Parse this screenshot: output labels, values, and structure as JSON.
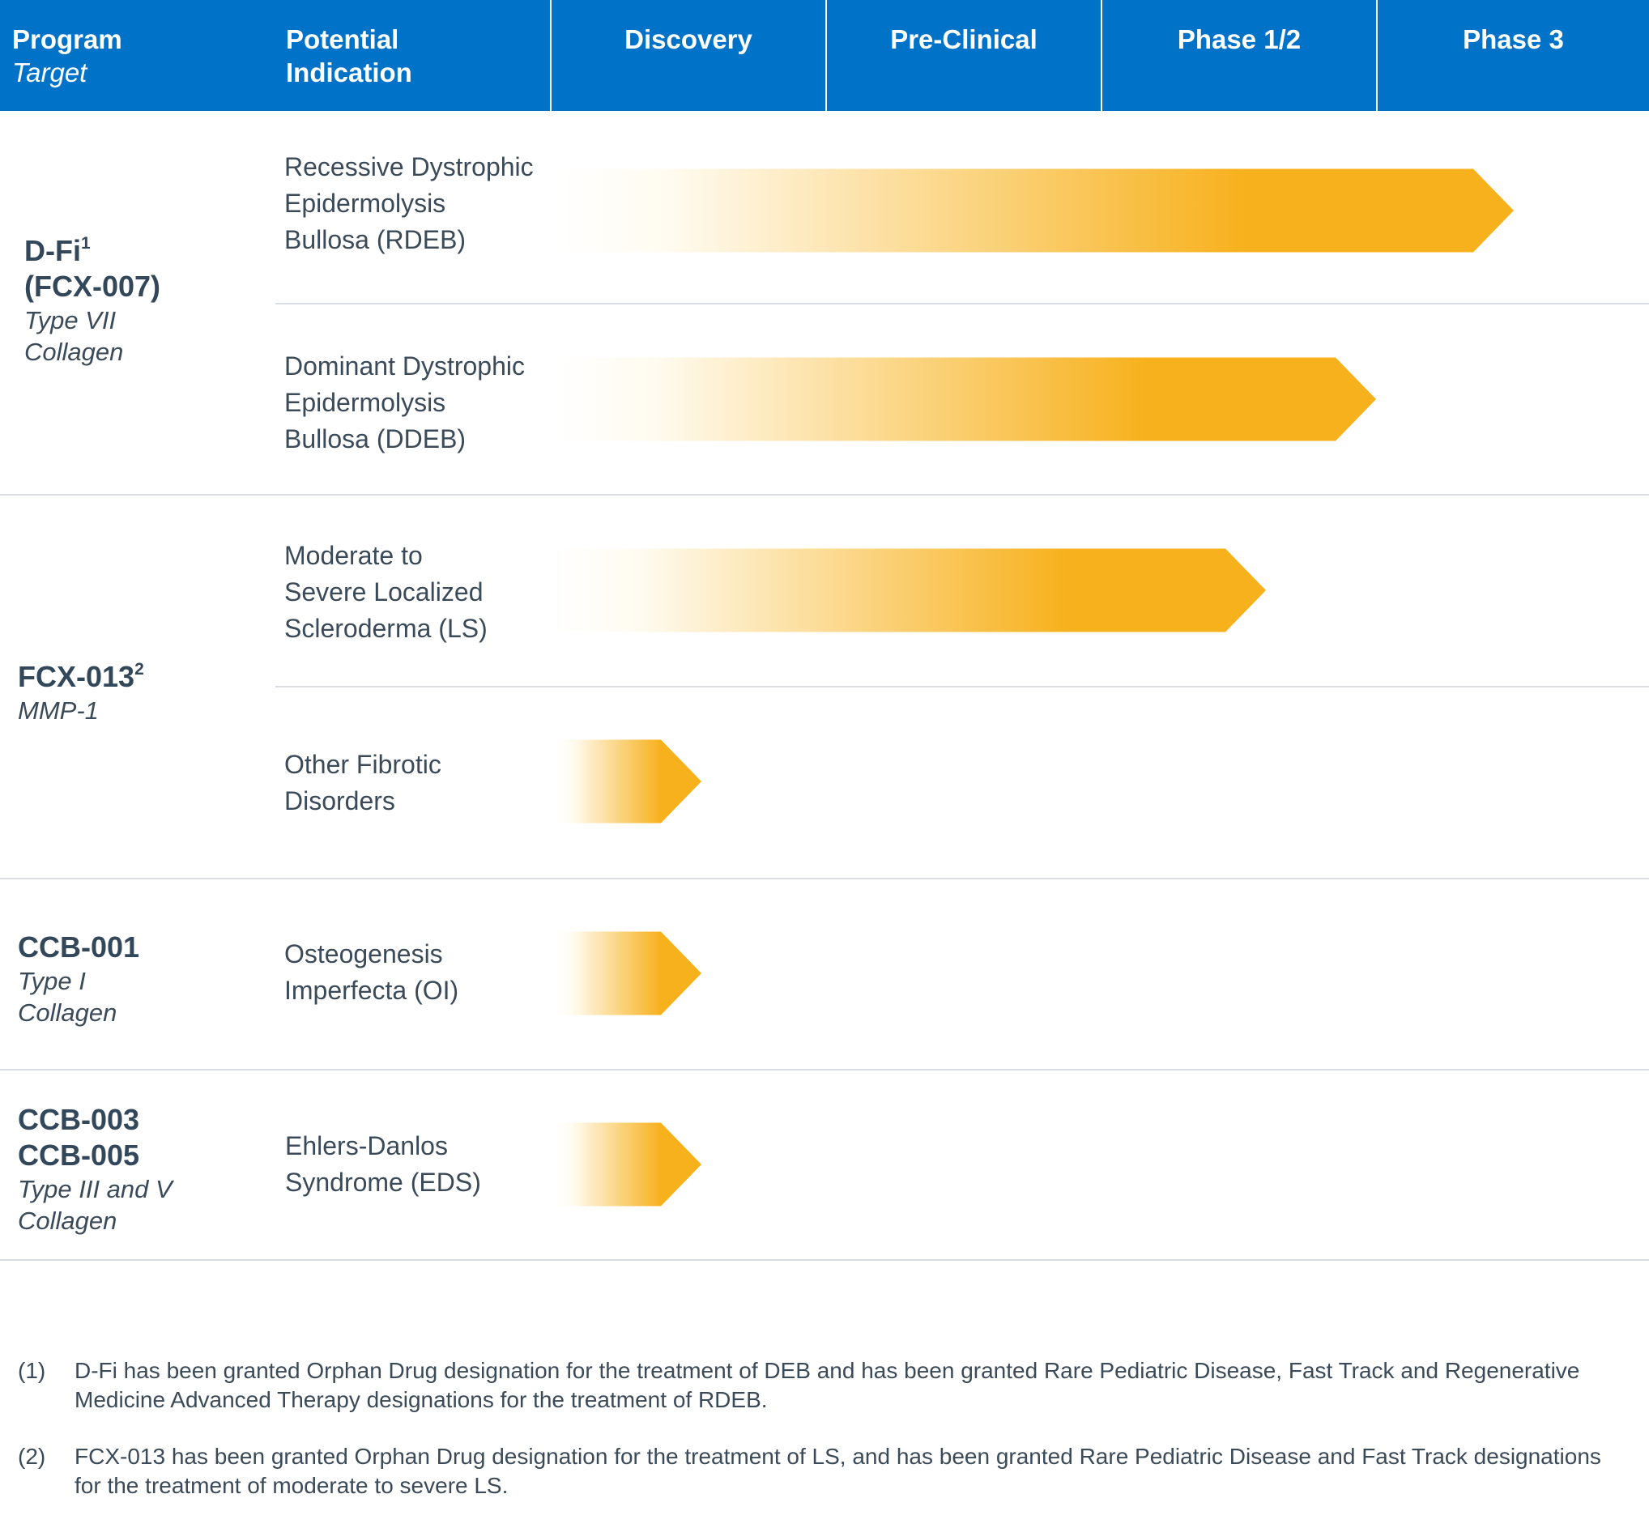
{
  "header": {
    "program_label": "Program",
    "target_label": "Target",
    "indication_label": "Potential Indication",
    "stages": [
      "Discovery",
      "Pre-Clinical",
      "Phase 1/2",
      "Phase 3"
    ]
  },
  "programs": [
    {
      "name_lines": [
        "D-Fi",
        "(FCX-007)"
      ],
      "name_sup": "1",
      "target_lines": [
        "Type VII",
        "Collagen"
      ]
    },
    {
      "name_lines": [
        "FCX-013"
      ],
      "name_sup": "2",
      "target_lines": [
        "MMP-1"
      ]
    },
    {
      "name_lines": [
        "CCB-001"
      ],
      "name_sup": "",
      "target_lines": [
        "Type I",
        "Collagen"
      ]
    },
    {
      "name_lines": [
        "CCB-003",
        "CCB-005"
      ],
      "name_sup": "",
      "target_lines": [
        "Type III and V",
        "Collagen"
      ]
    }
  ],
  "indications": [
    {
      "lines": [
        "Recessive Dystrophic",
        "Epidermolysis",
        "Bullosa (RDEB)"
      ]
    },
    {
      "lines": [
        "Dominant Dystrophic",
        "Epidermolysis",
        "Bullosa (DDEB)"
      ]
    },
    {
      "lines": [
        "Moderate to",
        "Severe Localized",
        "Scleroderma (LS)"
      ]
    },
    {
      "lines": [
        "Other Fibrotic",
        "Disorders"
      ]
    },
    {
      "lines": [
        "Osteogenesis",
        "Imperfecta (OI)"
      ]
    },
    {
      "lines": [
        "Ehlers-Danlos",
        "Syndrome (EDS)"
      ]
    }
  ],
  "chart_data": {
    "type": "bar",
    "orientation": "horizontal",
    "stage_axis": [
      "Discovery",
      "Pre-Clinical",
      "Phase 1/2",
      "Phase 3"
    ],
    "categories": [
      "Recessive Dystrophic Epidermolysis Bullosa (RDEB)",
      "Dominant Dystrophic Epidermolysis Bullosa (DDEB)",
      "Moderate to Severe Localized Scleroderma (LS)",
      "Other Fibrotic Disorders",
      "Osteogenesis Imperfecta (OI)",
      "Ehlers-Danlos Syndrome (EDS)"
    ],
    "values": [
      3.5,
      3.0,
      2.6,
      0.55,
      0.55,
      0.55
    ],
    "xlim": [
      0,
      4
    ],
    "bar_color": "#f7b11d",
    "bar_gradient_start": "#fffbf0"
  },
  "footnotes": [
    {
      "num": "(1)",
      "text": "D-Fi has been granted Orphan Drug designation for the treatment of DEB and has been granted Rare Pediatric Disease, Fast Track and Regenerative Medicine Advanced Therapy designations for the treatment of RDEB."
    },
    {
      "num": "(2)",
      "text": "FCX-013 has been granted Orphan Drug designation for the treatment of LS, and has been granted Rare Pediatric Disease and Fast Track designations for the treatment of moderate to severe LS."
    }
  ]
}
